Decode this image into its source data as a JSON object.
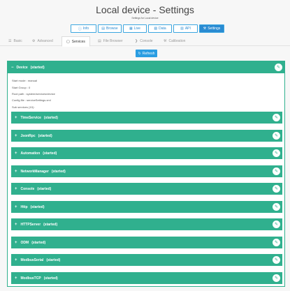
{
  "header": {
    "title": "Local device - Settings",
    "subtitle": "Settings for Local device"
  },
  "topnav": [
    {
      "label": "Info",
      "icon": "info-icon",
      "glyph": "ⓘ"
    },
    {
      "label": "Browse",
      "icon": "folder-icon",
      "glyph": "▤"
    },
    {
      "label": "Live",
      "icon": "live-icon",
      "glyph": "▦"
    },
    {
      "label": "Data",
      "icon": "file-icon",
      "glyph": "▧"
    },
    {
      "label": "API",
      "icon": "api-icon",
      "glyph": "▥"
    },
    {
      "label": "Settings",
      "icon": "wrench-icon",
      "glyph": "⚒"
    }
  ],
  "tabs": [
    {
      "label": "Basic",
      "glyph": "☰"
    },
    {
      "label": "Advanced",
      "glyph": "⚙"
    },
    {
      "label": "Services",
      "glyph": "▢"
    },
    {
      "label": "File Browser",
      "glyph": "▤"
    },
    {
      "label": "Console",
      "glyph": "❯"
    },
    {
      "label": "Calibration",
      "glyph": "⚒"
    }
  ],
  "refresh": {
    "label": "Refresh",
    "glyph": "↻"
  },
  "device": {
    "name": "Device",
    "state": "(started)",
    "toggle": "−",
    "start_mode": "Start mode : manual",
    "start_group": "Start Group : 0",
    "root_path": "Root path : system/services/device",
    "config_file": "Config file : serviceSettings.xml",
    "sub_services": "Sub services (10) :"
  },
  "services": [
    {
      "name": "TimeService",
      "state": "(started)"
    },
    {
      "name": "JsonRpc",
      "state": "(started)"
    },
    {
      "name": "Automation",
      "state": "(started)"
    },
    {
      "name": "NetworkManager",
      "state": "(started)"
    },
    {
      "name": "Console",
      "state": "(started)"
    },
    {
      "name": "Http",
      "state": "(started)"
    },
    {
      "name": "HTTPServer",
      "state": "(started)"
    },
    {
      "name": "ODM",
      "state": "(started)"
    },
    {
      "name": "ModbusSerial",
      "state": "(started)"
    },
    {
      "name": "ModbusTCP",
      "state": "(started)"
    }
  ],
  "icons": {
    "plus": "+",
    "edit": "✎"
  },
  "colors": {
    "accent": "#30b08e",
    "primary": "#2a8bd2"
  }
}
